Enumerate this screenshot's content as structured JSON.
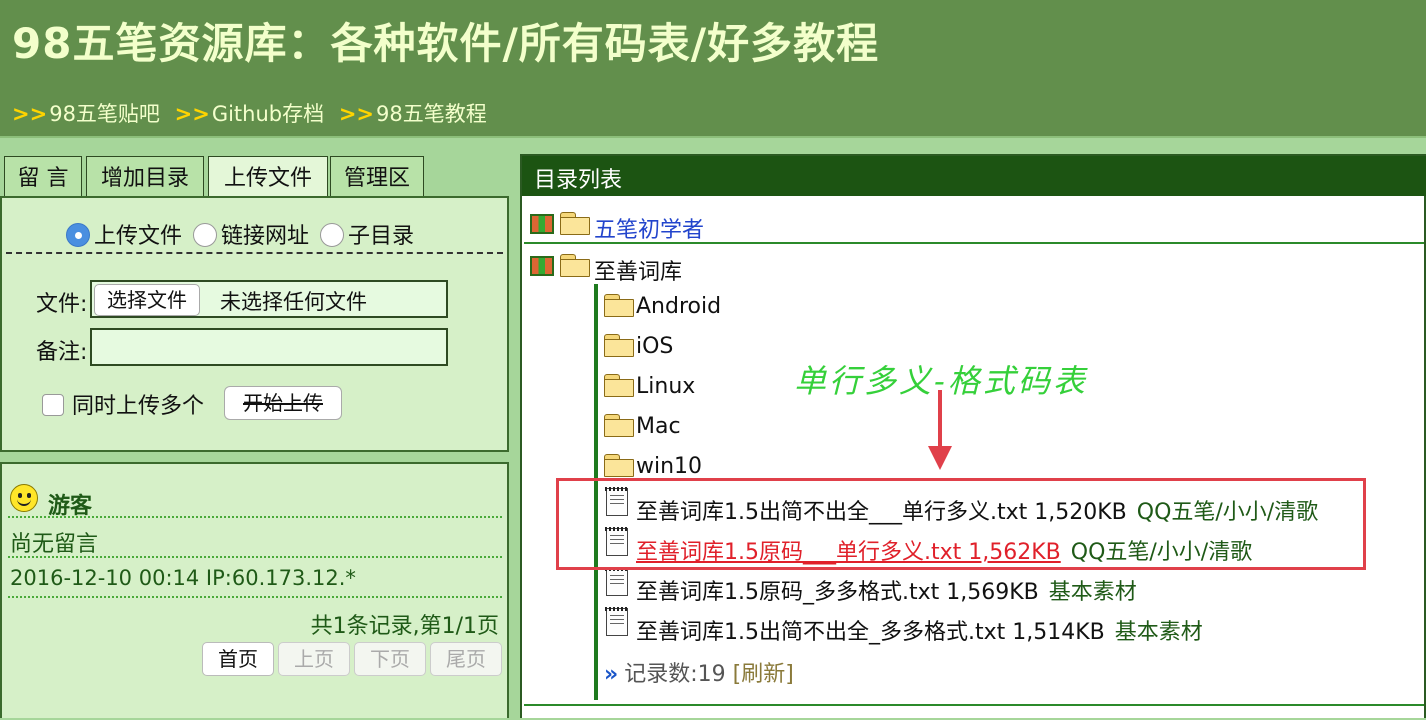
{
  "header": {
    "title": "98五笔资源库：各种软件/所有码表/好多教程",
    "nav": [
      {
        "arrow": ">>",
        "label": "98五笔贴吧"
      },
      {
        "arrow": ">>",
        "label": "Github存档"
      },
      {
        "arrow": ">>",
        "label": "98五笔教程"
      }
    ]
  },
  "tabs": [
    "留 言",
    "增加目录",
    "上传文件",
    "管理区"
  ],
  "active_tab": "上传文件",
  "upload": {
    "radios": [
      "上传文件",
      "链接网址",
      "子目录"
    ],
    "selected_radio": "上传文件",
    "file_label": "文件:",
    "choose_file": "选择文件",
    "no_file": "未选择任何文件",
    "note_label": "备注:",
    "note_value": "",
    "multi_label": "同时上传多个",
    "start_upload": "开始上传"
  },
  "messages": {
    "guest": "游客",
    "content": "尚无留言",
    "meta": "2016-12-10 00:14  IP:60.173.12.*",
    "summary": "共1条记录,第1/1页",
    "pages": [
      "首页",
      "上页",
      "下页",
      "尾页"
    ]
  },
  "directory": {
    "title": "目录列表",
    "top_folders": [
      "五笔初学者",
      "至善词库"
    ],
    "sub_folders": [
      "Android",
      "iOS",
      "Linux",
      "Mac",
      "win10"
    ],
    "files": [
      {
        "name": "至善词库1.5出简不出全___单行多义.txt 1,520KB",
        "tag": "QQ五笔/小小/清歌",
        "highlight": false
      },
      {
        "name": "至善词库1.5原码___单行多义.txt 1,562KB",
        "tag": "QQ五笔/小小/清歌",
        "highlight": true
      },
      {
        "name": "至善词库1.5原码_多多格式.txt 1,569KB",
        "tag": "基本素材",
        "highlight": false
      },
      {
        "name": "至善词库1.5出简不出全_多多格式.txt 1,514KB",
        "tag": "基本素材",
        "highlight": false
      }
    ],
    "record_count_arrow": "»",
    "record_count": "记录数:19",
    "refresh": "[刷新]"
  },
  "annotation": "单行多义-格式码表",
  "icons": {
    "smiley": "smiley-icon",
    "folder": "folder-icon",
    "file": "file-icon",
    "tree": "color-box-icon"
  },
  "colors": {
    "header_bg": "#628f4c",
    "panel_bg": "#d6f0c8",
    "dir_header": "#1c5412",
    "highlight": "#e0404a",
    "annotation": "#35d03a"
  }
}
